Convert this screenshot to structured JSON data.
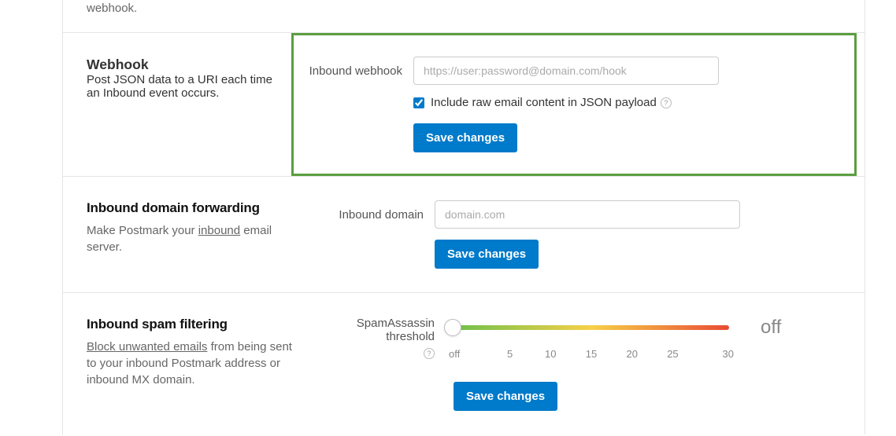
{
  "topRemnant": "webhook.",
  "webhook": {
    "title": "Webhook",
    "desc_pre": "Post JSON data to a URI each time an ",
    "desc_link": "Inbound",
    "desc_post": " event occurs.",
    "fieldLabel": "Inbound webhook",
    "placeholder": "https://user:password@domain.com/hook",
    "checkboxLabel": "Include raw email content in JSON payload",
    "saveLabel": "Save changes"
  },
  "domainForwarding": {
    "title": "Inbound domain forwarding",
    "desc_pre": "Make Postmark your ",
    "desc_link": "inbound",
    "desc_post": " email server.",
    "fieldLabel": "Inbound domain",
    "placeholder": "domain.com",
    "saveLabel": "Save changes"
  },
  "spamFiltering": {
    "title": "Inbound spam filtering",
    "desc_link": "Block unwanted emails",
    "desc_post": " from being sent to your inbound Postmark address or inbound MX domain.",
    "thresholdLabel": "SpamAssassin threshold",
    "currentValue": "off",
    "ticks": [
      "off",
      "5",
      "10",
      "15",
      "20",
      "25",
      "30"
    ],
    "saveLabel": "Save changes"
  }
}
